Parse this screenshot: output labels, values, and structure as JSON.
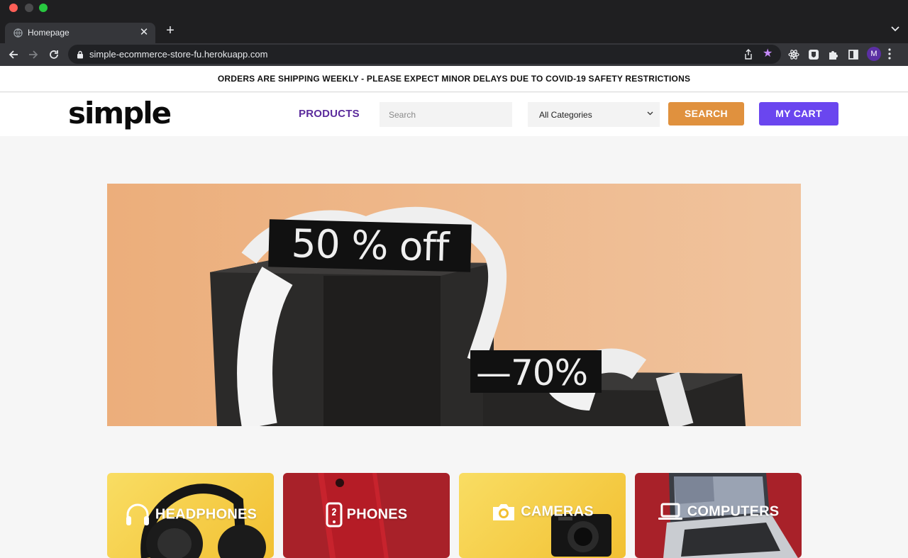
{
  "browser": {
    "tab_title": "Homepage",
    "url": "simple-ecommerce-store-fu.herokuapp.com",
    "profile_initial": "M"
  },
  "announcement": "ORDERS ARE SHIPPING WEEKLY - PLEASE EXPECT MINOR DELAYS DUE TO COVID-19 SAFETY RESTRICTIONS",
  "header": {
    "logo": "simple",
    "nav_products": "PRODUCTS",
    "search_placeholder": "Search",
    "category_selected": "All Categories",
    "search_button": "SEARCH",
    "cart_button": "MY CART"
  },
  "hero": {
    "tag_primary": "50 % off",
    "tag_secondary": "—70%"
  },
  "categories": [
    {
      "label": "HEADPHONES",
      "icon": "headphones-icon"
    },
    {
      "label": "PHONES",
      "icon": "phone-icon"
    },
    {
      "label": "CAMERAS",
      "icon": "camera-icon"
    },
    {
      "label": "COMPUTERS",
      "icon": "laptop-icon"
    }
  ],
  "colors": {
    "brand_purple": "#5b2b9c",
    "search_orange": "#e0913e",
    "cart_purple": "#6a46ef",
    "category_yellow": "#f2c032",
    "category_red": "#a82129"
  }
}
